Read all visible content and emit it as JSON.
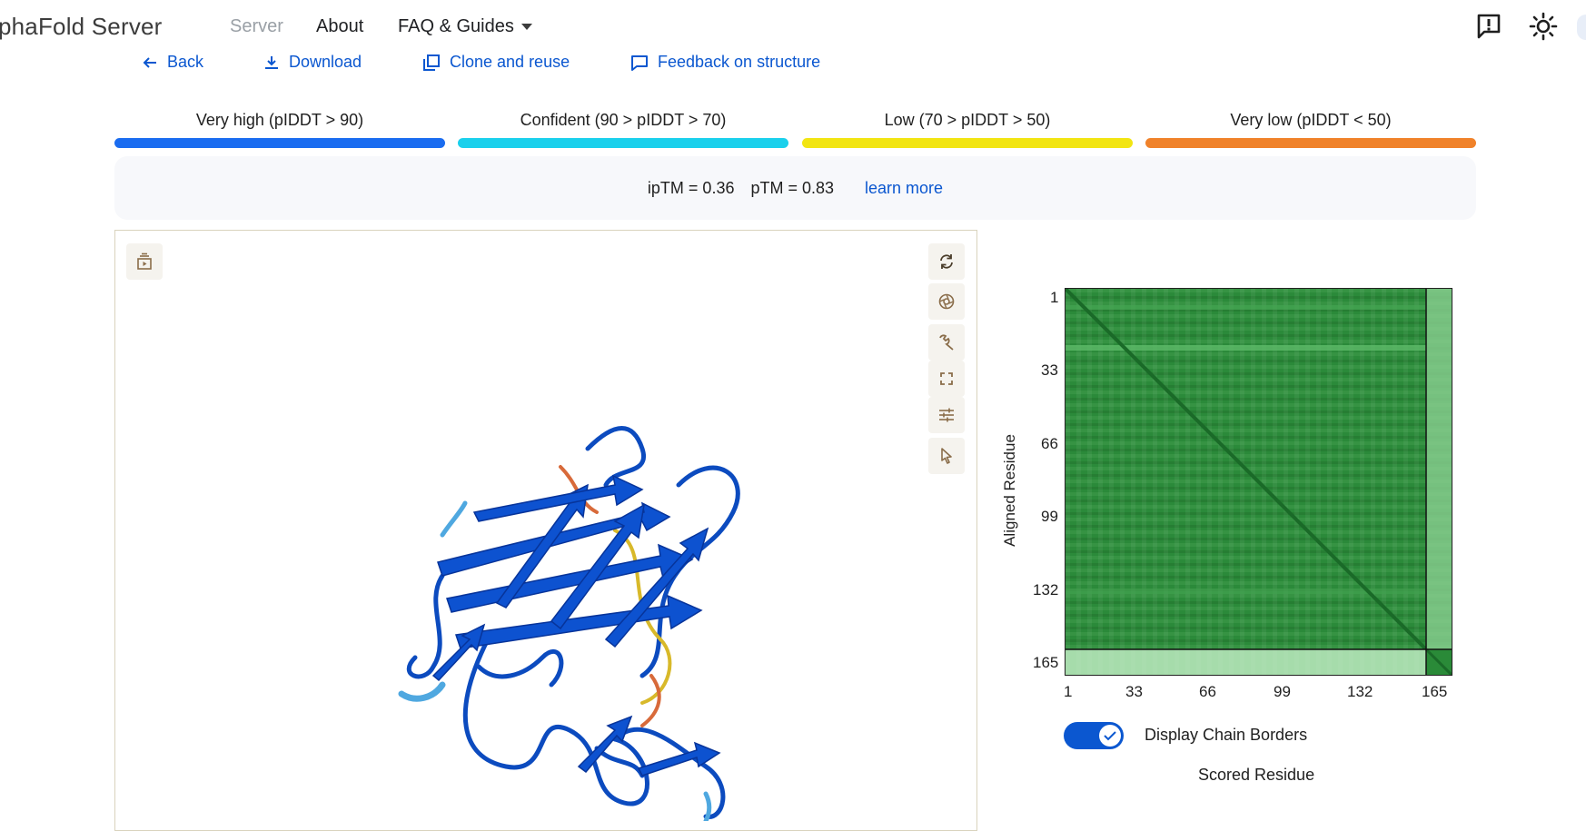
{
  "nav": {
    "app_title": "lphaFold Server",
    "links": [
      "Server",
      "About",
      "FAQ & Guides"
    ]
  },
  "actions": [
    "Back",
    "Download",
    "Clone and reuse",
    "Feedback on structure"
  ],
  "legend": [
    {
      "label": "Very high (pIDDT > 90)",
      "color": "#1a6cf0"
    },
    {
      "label": "Confident (90 > pIDDT > 70)",
      "color": "#1ad0ec"
    },
    {
      "label": "Low (70 > pIDDT > 50)",
      "color": "#f2e512"
    },
    {
      "label": "Very low (pIDDT < 50)",
      "color": "#f0822a"
    }
  ],
  "scores": {
    "iptm": "ipTM = 0.36",
    "ptm": "pTM = 0.83",
    "learn_more": "learn more"
  },
  "viewer": {
    "toolbar_icons": [
      "reset-view-icon",
      "spin-icon",
      "wrench-icon",
      "fullscreen-icon",
      "settings-sliders-icon",
      "select-pointer-icon"
    ],
    "left_icon": "animation-panel-icon"
  },
  "pae": {
    "y_axis_label": "Aligned Residue",
    "x_axis_label": "Scored Residue",
    "y_ticks": [
      "1",
      "33",
      "66",
      "99",
      "132",
      "165"
    ],
    "x_ticks": [
      "1",
      "33",
      "66",
      "99",
      "132",
      "165"
    ],
    "toggle_label": "Display Chain Borders",
    "toggle_on": true
  },
  "colors": {
    "accent": "#0b57d0",
    "pae_dark": "#1e7a2e",
    "pae_light": "#cdeccd"
  }
}
